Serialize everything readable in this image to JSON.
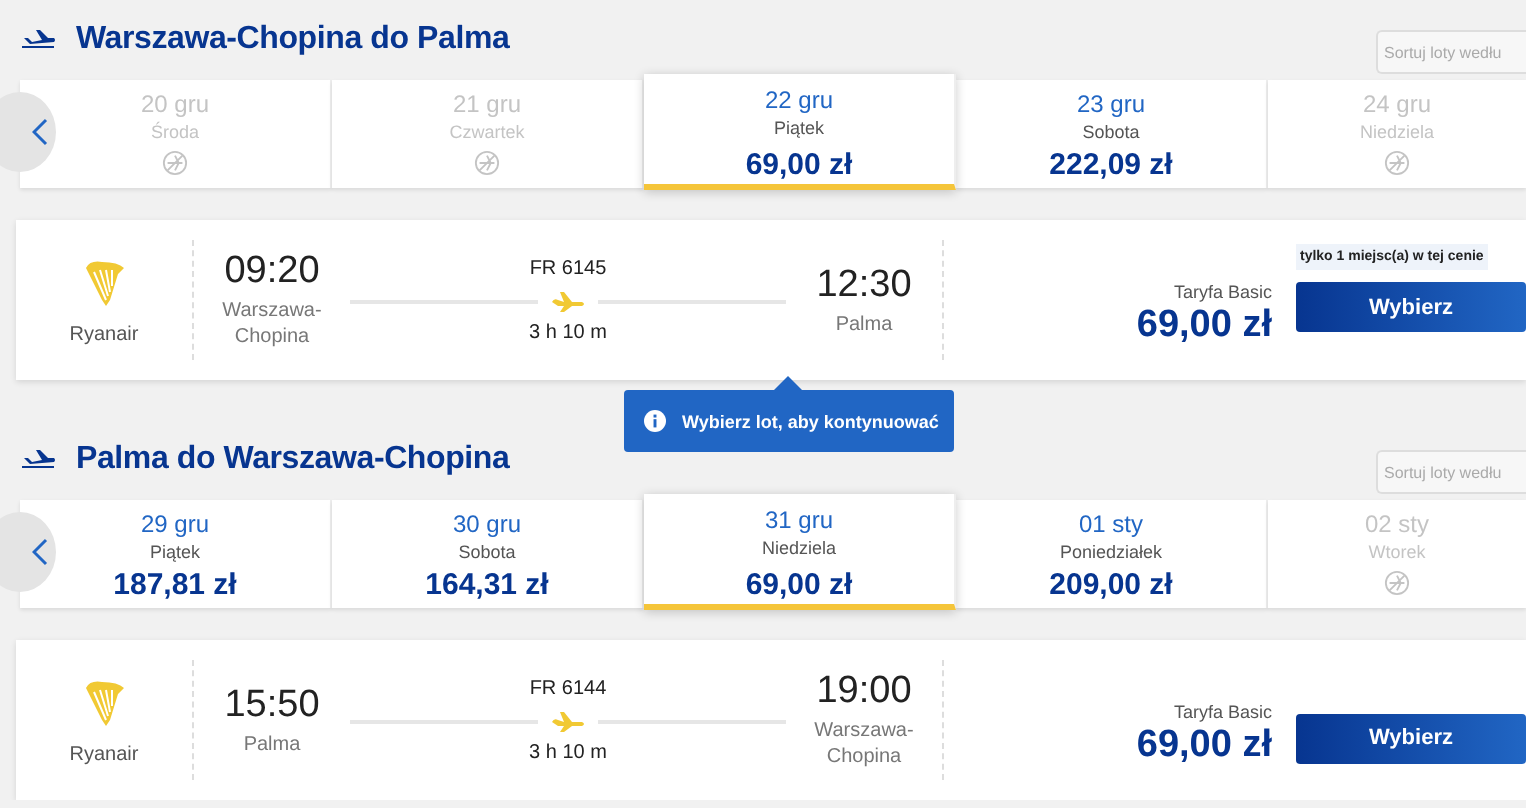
{
  "sections": [
    {
      "title": "Warszawa-Chopina do Palma",
      "sort_placeholder": "Sortuj loty wedłu",
      "dates": [
        {
          "date": "20 gru",
          "weekday": "Środa",
          "available": false,
          "selected": false
        },
        {
          "date": "21 gru",
          "weekday": "Czwartek",
          "available": false,
          "selected": false
        },
        {
          "date": "22 gru",
          "weekday": "Piątek",
          "available": true,
          "price": "69,00 zł",
          "selected": true
        },
        {
          "date": "23 gru",
          "weekday": "Sobota",
          "available": true,
          "price": "222,09 zł",
          "selected": false
        },
        {
          "date": "24 gru",
          "weekday": "Niedziela",
          "available": false,
          "selected": false
        }
      ],
      "flight": {
        "airline": "Ryanair",
        "depart_time": "09:20",
        "depart_airport": "Warszawa-Chopina",
        "flight_number": "FR 6145",
        "duration": "3 h 10 m",
        "arrive_time": "12:30",
        "arrive_airport": "Palma",
        "badge": "tylko 1 miejsc(a) w tej cenie",
        "fare": "Taryfa Basic",
        "price": "69,00 zł",
        "button": "Wybierz"
      }
    },
    {
      "title": "Palma do Warszawa-Chopina",
      "sort_placeholder": "Sortuj loty wedłu",
      "dates": [
        {
          "date": "29 gru",
          "weekday": "Piątek",
          "available": true,
          "price": "187,81 zł",
          "selected": false
        },
        {
          "date": "30 gru",
          "weekday": "Sobota",
          "available": true,
          "price": "164,31 zł",
          "selected": false
        },
        {
          "date": "31 gru",
          "weekday": "Niedziela",
          "available": true,
          "price": "69,00 zł",
          "selected": true
        },
        {
          "date": "01 sty",
          "weekday": "Poniedziałek",
          "available": true,
          "price": "209,00 zł",
          "selected": false
        },
        {
          "date": "02 sty",
          "weekday": "Wtorek",
          "available": false,
          "selected": false
        }
      ],
      "flight": {
        "airline": "Ryanair",
        "depart_time": "15:50",
        "depart_airport": "Palma",
        "flight_number": "FR 6144",
        "duration": "3 h 10 m",
        "arrive_time": "19:00",
        "arrive_airport": "Warszawa-Chopina",
        "fare": "Taryfa Basic",
        "price": "69,00 zł",
        "button": "Wybierz"
      }
    }
  ],
  "tooltip": {
    "text": "Wybierz lot, aby kontynuować"
  }
}
